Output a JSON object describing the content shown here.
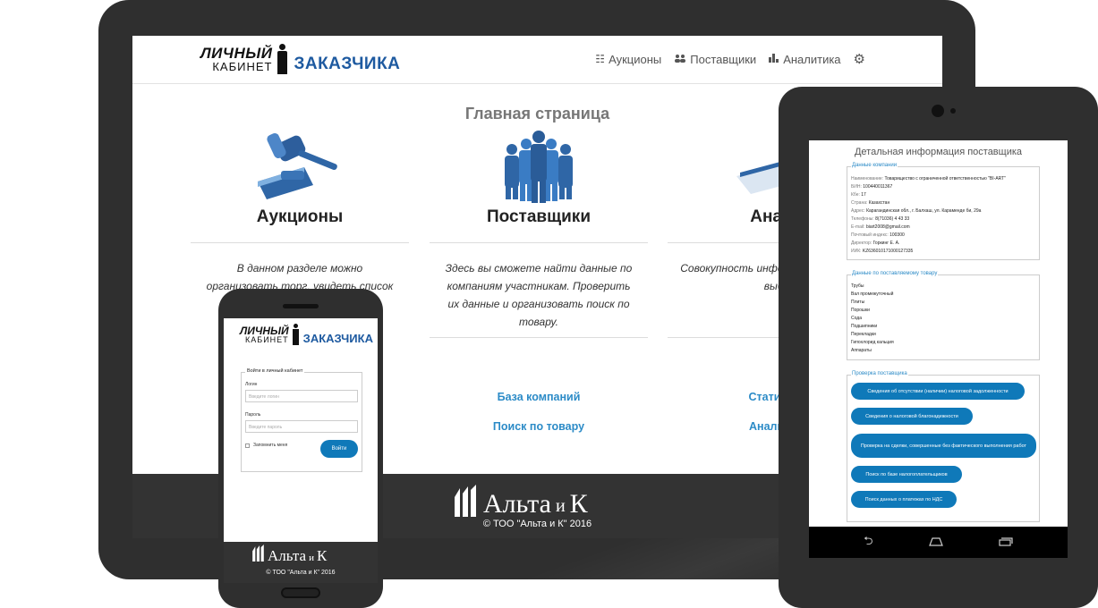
{
  "desktop": {
    "logo": {
      "line1": "ЛИЧНЫЙ",
      "line2": "КАБИНЕТ",
      "brand": "ЗАКАЗЧИКА"
    },
    "nav": [
      {
        "label": "Аукционы",
        "icon": "list-icon"
      },
      {
        "label": "Поставщики",
        "icon": "users-icon"
      },
      {
        "label": "Аналитика",
        "icon": "bar-chart-icon"
      }
    ],
    "settings_icon": "gear-icon",
    "title": "Главная страница",
    "columns": [
      {
        "title": "Аукционы",
        "icon": "gavel-icon",
        "text": "В данном разделе можно организовать торг, увидеть список активных и историю",
        "links": []
      },
      {
        "title": "Поставщики",
        "icon": "people-icon",
        "text": "Здесь вы сможете найти данные по компаниям участникам. Проверить их данные и организовать поиск по товару.",
        "links": [
          "База компаний",
          "Поиск по товару"
        ]
      },
      {
        "title": "Анали",
        "icon": "analytics-icon",
        "text": "Совокупность инфор статистику по выбр",
        "links": [
          "Статистик",
          "Анализ эк"
        ]
      }
    ],
    "footer": {
      "brand": "Альта",
      "brand_conj": "и",
      "brand_k": "К",
      "copyright": "© ТОО \"Альта и К\" 2016"
    }
  },
  "tablet": {
    "title": "Детальная информация поставщика",
    "company": {
      "legend": "Данные компании",
      "rows": [
        {
          "k": "Наименование:",
          "v": "Товарищество с ограниченной ответственностью \"BI-ART\""
        },
        {
          "k": "БИН:",
          "v": "100440011367"
        },
        {
          "k": "Кбе:",
          "v": "17"
        },
        {
          "k": "Страна:",
          "v": "Казахстан"
        },
        {
          "k": "Адрес:",
          "v": "Карагандинская обл., г. Балхаш, ул. Караменде би, 29а"
        },
        {
          "k": "Телефоны:",
          "v": "8(71036) 4 43 33"
        },
        {
          "k": "E-mail:",
          "v": "biart2008@gmail.com"
        },
        {
          "k": "Почтовый индекс:",
          "v": "100300"
        },
        {
          "k": "Директор:",
          "v": "Горкинг Е. А."
        },
        {
          "k": "ИИК:",
          "v": "KZ636010171000127335"
        }
      ]
    },
    "goods": {
      "legend": "Данные по поставляемому товару",
      "items": [
        "Трубы",
        "Вал промежуточный",
        "Плиты",
        "Порошки",
        "Сода",
        "Подшипники",
        "Перекладки",
        "Гипохлорид кальция",
        "Аппараты"
      ]
    },
    "check": {
      "legend": "Проверка поставщика",
      "buttons": [
        "Сведения об отсутствии (наличии) налоговой задолженности",
        "Сведения о налоговой благонадежности",
        "Проверка на сделки, совершенные без фактического выполнения работ",
        "Поиск по базе налогоплательщиков",
        "Поиск данных о платежах по НДС"
      ]
    },
    "nav": {
      "back": "back-icon",
      "home": "home-icon",
      "recent": "recent-apps-icon"
    }
  },
  "phone": {
    "logo": {
      "line1": "ЛИЧНЫЙ",
      "line2": "КАБИНЕТ",
      "brand": "ЗАКАЗЧИКА"
    },
    "login": {
      "legend": "Войти в личный кабинет",
      "login_label": "Логин",
      "login_placeholder": "Введите логин",
      "password_label": "Пароль",
      "password_placeholder": "Введите пароль",
      "remember": "Запомнить меня",
      "submit": "Войти"
    },
    "footer": {
      "brand": "Альта",
      "brand_conj": "и",
      "brand_k": "К",
      "copyright": "© ТОО \"Альта и К\" 2016"
    }
  }
}
